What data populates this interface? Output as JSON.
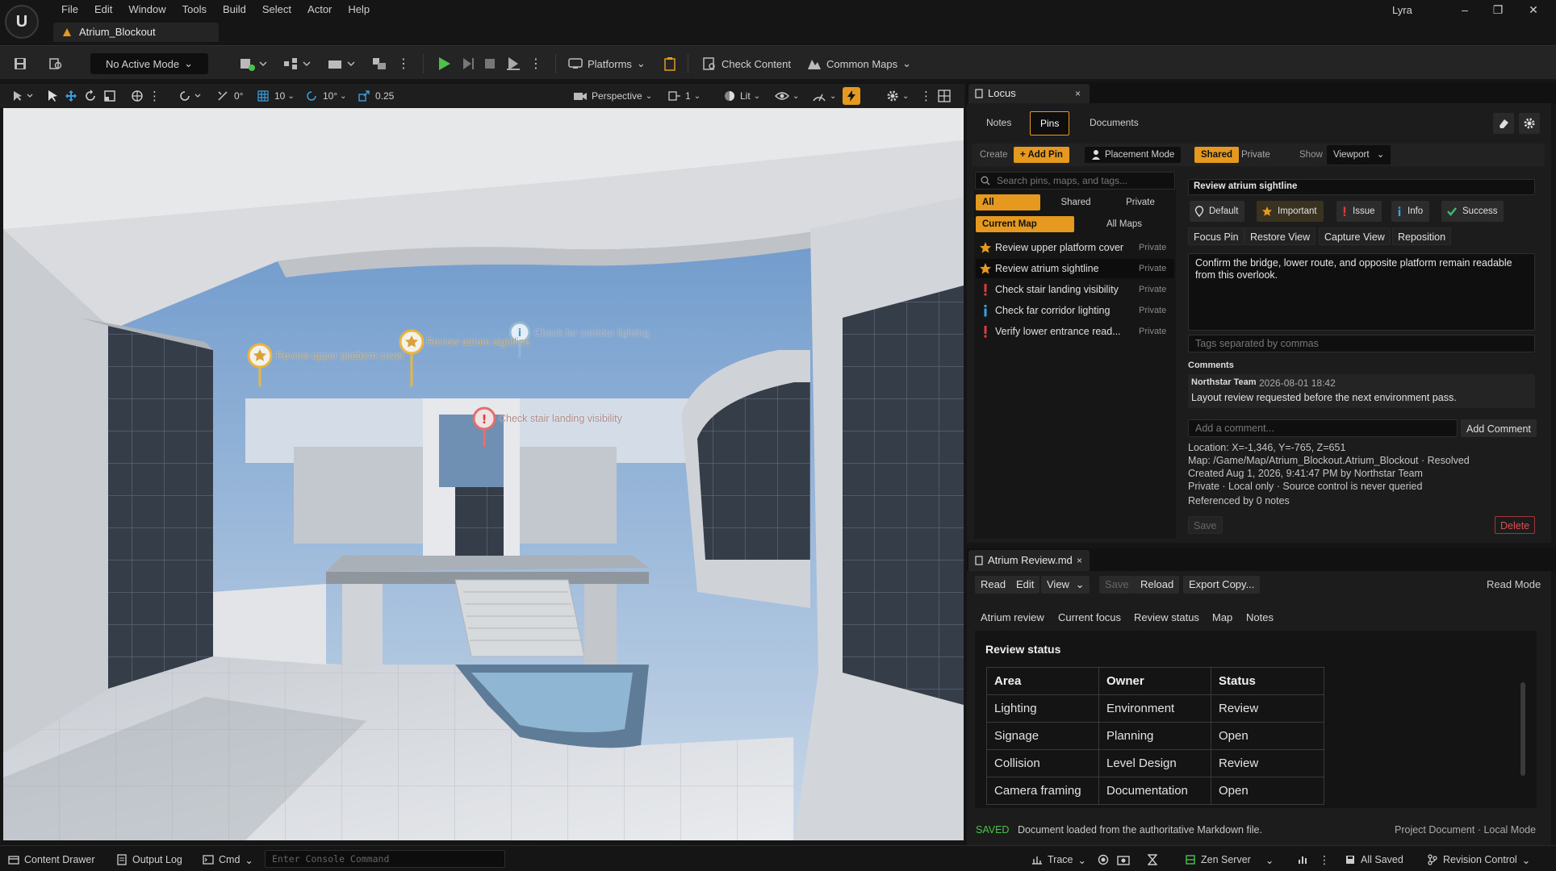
{
  "menubar": {
    "logo": "U",
    "items": [
      "File",
      "Edit",
      "Window",
      "Tools",
      "Build",
      "Select",
      "Actor",
      "Help"
    ],
    "project": "Lyra",
    "window_controls": [
      "–",
      "❐",
      "✕"
    ]
  },
  "level_tab": {
    "label": "Atrium_Blockout"
  },
  "toolbar": {
    "mode": "No Active Mode",
    "platforms": "Platforms",
    "check_content": "Check Content",
    "common_maps": "Common Maps"
  },
  "viewport_toolbar": {
    "translate_snap": "0°",
    "grid_snap": "10",
    "rotate_snap": "10°",
    "scale_snap": "0.25",
    "view_mode": "Perspective",
    "camera_speed": "1",
    "lighting": "Lit"
  },
  "viewport_pins": [
    {
      "label": "Review upper platform cover",
      "type": "important"
    },
    {
      "label": "Review atrium sightline",
      "type": "important"
    },
    {
      "label": "Check far corridor lighting",
      "type": "info"
    },
    {
      "label": "Check stair landing visibility",
      "type": "issue"
    }
  ],
  "locus": {
    "tab_title": "Locus",
    "tabs": [
      "Notes",
      "Pins",
      "Documents"
    ],
    "active_tab": "Pins",
    "create_label": "Create",
    "add_pin": "+ Add Pin",
    "placement_mode": "Placement Mode",
    "scope": [
      "Shared",
      "Private"
    ],
    "show_label": "Show",
    "show_value": "Viewport",
    "search_placeholder": "Search pins, maps, and tags...",
    "filters": [
      "All",
      "Shared",
      "Private"
    ],
    "map_filters": [
      "Current Map",
      "All Maps"
    ],
    "pins": [
      {
        "title": "Review upper platform cover",
        "visibility": "Private",
        "type": "important"
      },
      {
        "title": "Review atrium sightline",
        "visibility": "Private",
        "type": "important"
      },
      {
        "title": "Check stair landing visibility",
        "visibility": "Private",
        "type": "issue"
      },
      {
        "title": "Check far corridor lighting",
        "visibility": "Private",
        "type": "info"
      },
      {
        "title": "Verify lower entrance read...",
        "visibility": "Private",
        "type": "issue"
      }
    ],
    "detail": {
      "title": "Review atrium sightline",
      "categories": [
        "Default",
        "Important",
        "Issue",
        "Info",
        "Success"
      ],
      "actions": [
        "Focus Pin",
        "Restore View",
        "Capture View",
        "Reposition"
      ],
      "description": "Confirm the bridge, lower route, and opposite platform remain readable from this overlook.",
      "tags_placeholder": "Tags separated by commas",
      "comments_heading": "Comments",
      "comment": {
        "author": "Northstar Team",
        "timestamp": "2026-08-01 18:42",
        "text": "Layout review requested before the next environment pass."
      },
      "comment_placeholder": "Add a comment...",
      "add_comment": "Add Comment",
      "meta": [
        "Location: X=-1,346, Y=-765, Z=651",
        "Map: /Game/Map/Atrium_Blockout.Atrium_Blockout · Resolved",
        "Created Aug 1, 2026, 9:41:47 PM by Northstar Team",
        "Private · Local only · Source control is never queried",
        "Referenced by 0 notes"
      ],
      "save": "Save",
      "delete": "Delete"
    }
  },
  "document": {
    "tab_title": "Atrium Review.md",
    "buttons": [
      "Read",
      "Edit",
      "View",
      "Save",
      "Reload",
      "Export Copy..."
    ],
    "mode": "Read Mode",
    "nav": [
      "Atrium review",
      "Current focus",
      "Review status",
      "Map",
      "Notes"
    ],
    "heading": "Review status",
    "table": {
      "headers": [
        "Area",
        "Owner",
        "Status"
      ],
      "rows": [
        [
          "Lighting",
          "Environment",
          "Review"
        ],
        [
          "Signage",
          "Planning",
          "Open"
        ],
        [
          "Collision",
          "Level Design",
          "Review"
        ],
        [
          "Camera framing",
          "Documentation",
          "Open"
        ]
      ]
    },
    "status_badge": "SAVED",
    "status_text": "Document loaded from the authoritative Markdown file.",
    "status_right": "Project Document · Local Mode"
  },
  "statusbar": {
    "content_drawer": "Content Drawer",
    "output_log": "Output Log",
    "cmd": "Cmd",
    "console_placeholder": "Enter Console Command",
    "trace": "Trace",
    "zen_server": "Zen Server",
    "all_saved": "All Saved",
    "revision_control": "Revision Control"
  },
  "colors": {
    "accent": "#e59a1f",
    "issue": "#e03a3a",
    "info": "#3aa0e0",
    "success": "#3ac06a",
    "play": "#4cc24c",
    "delete": "#e05050"
  }
}
